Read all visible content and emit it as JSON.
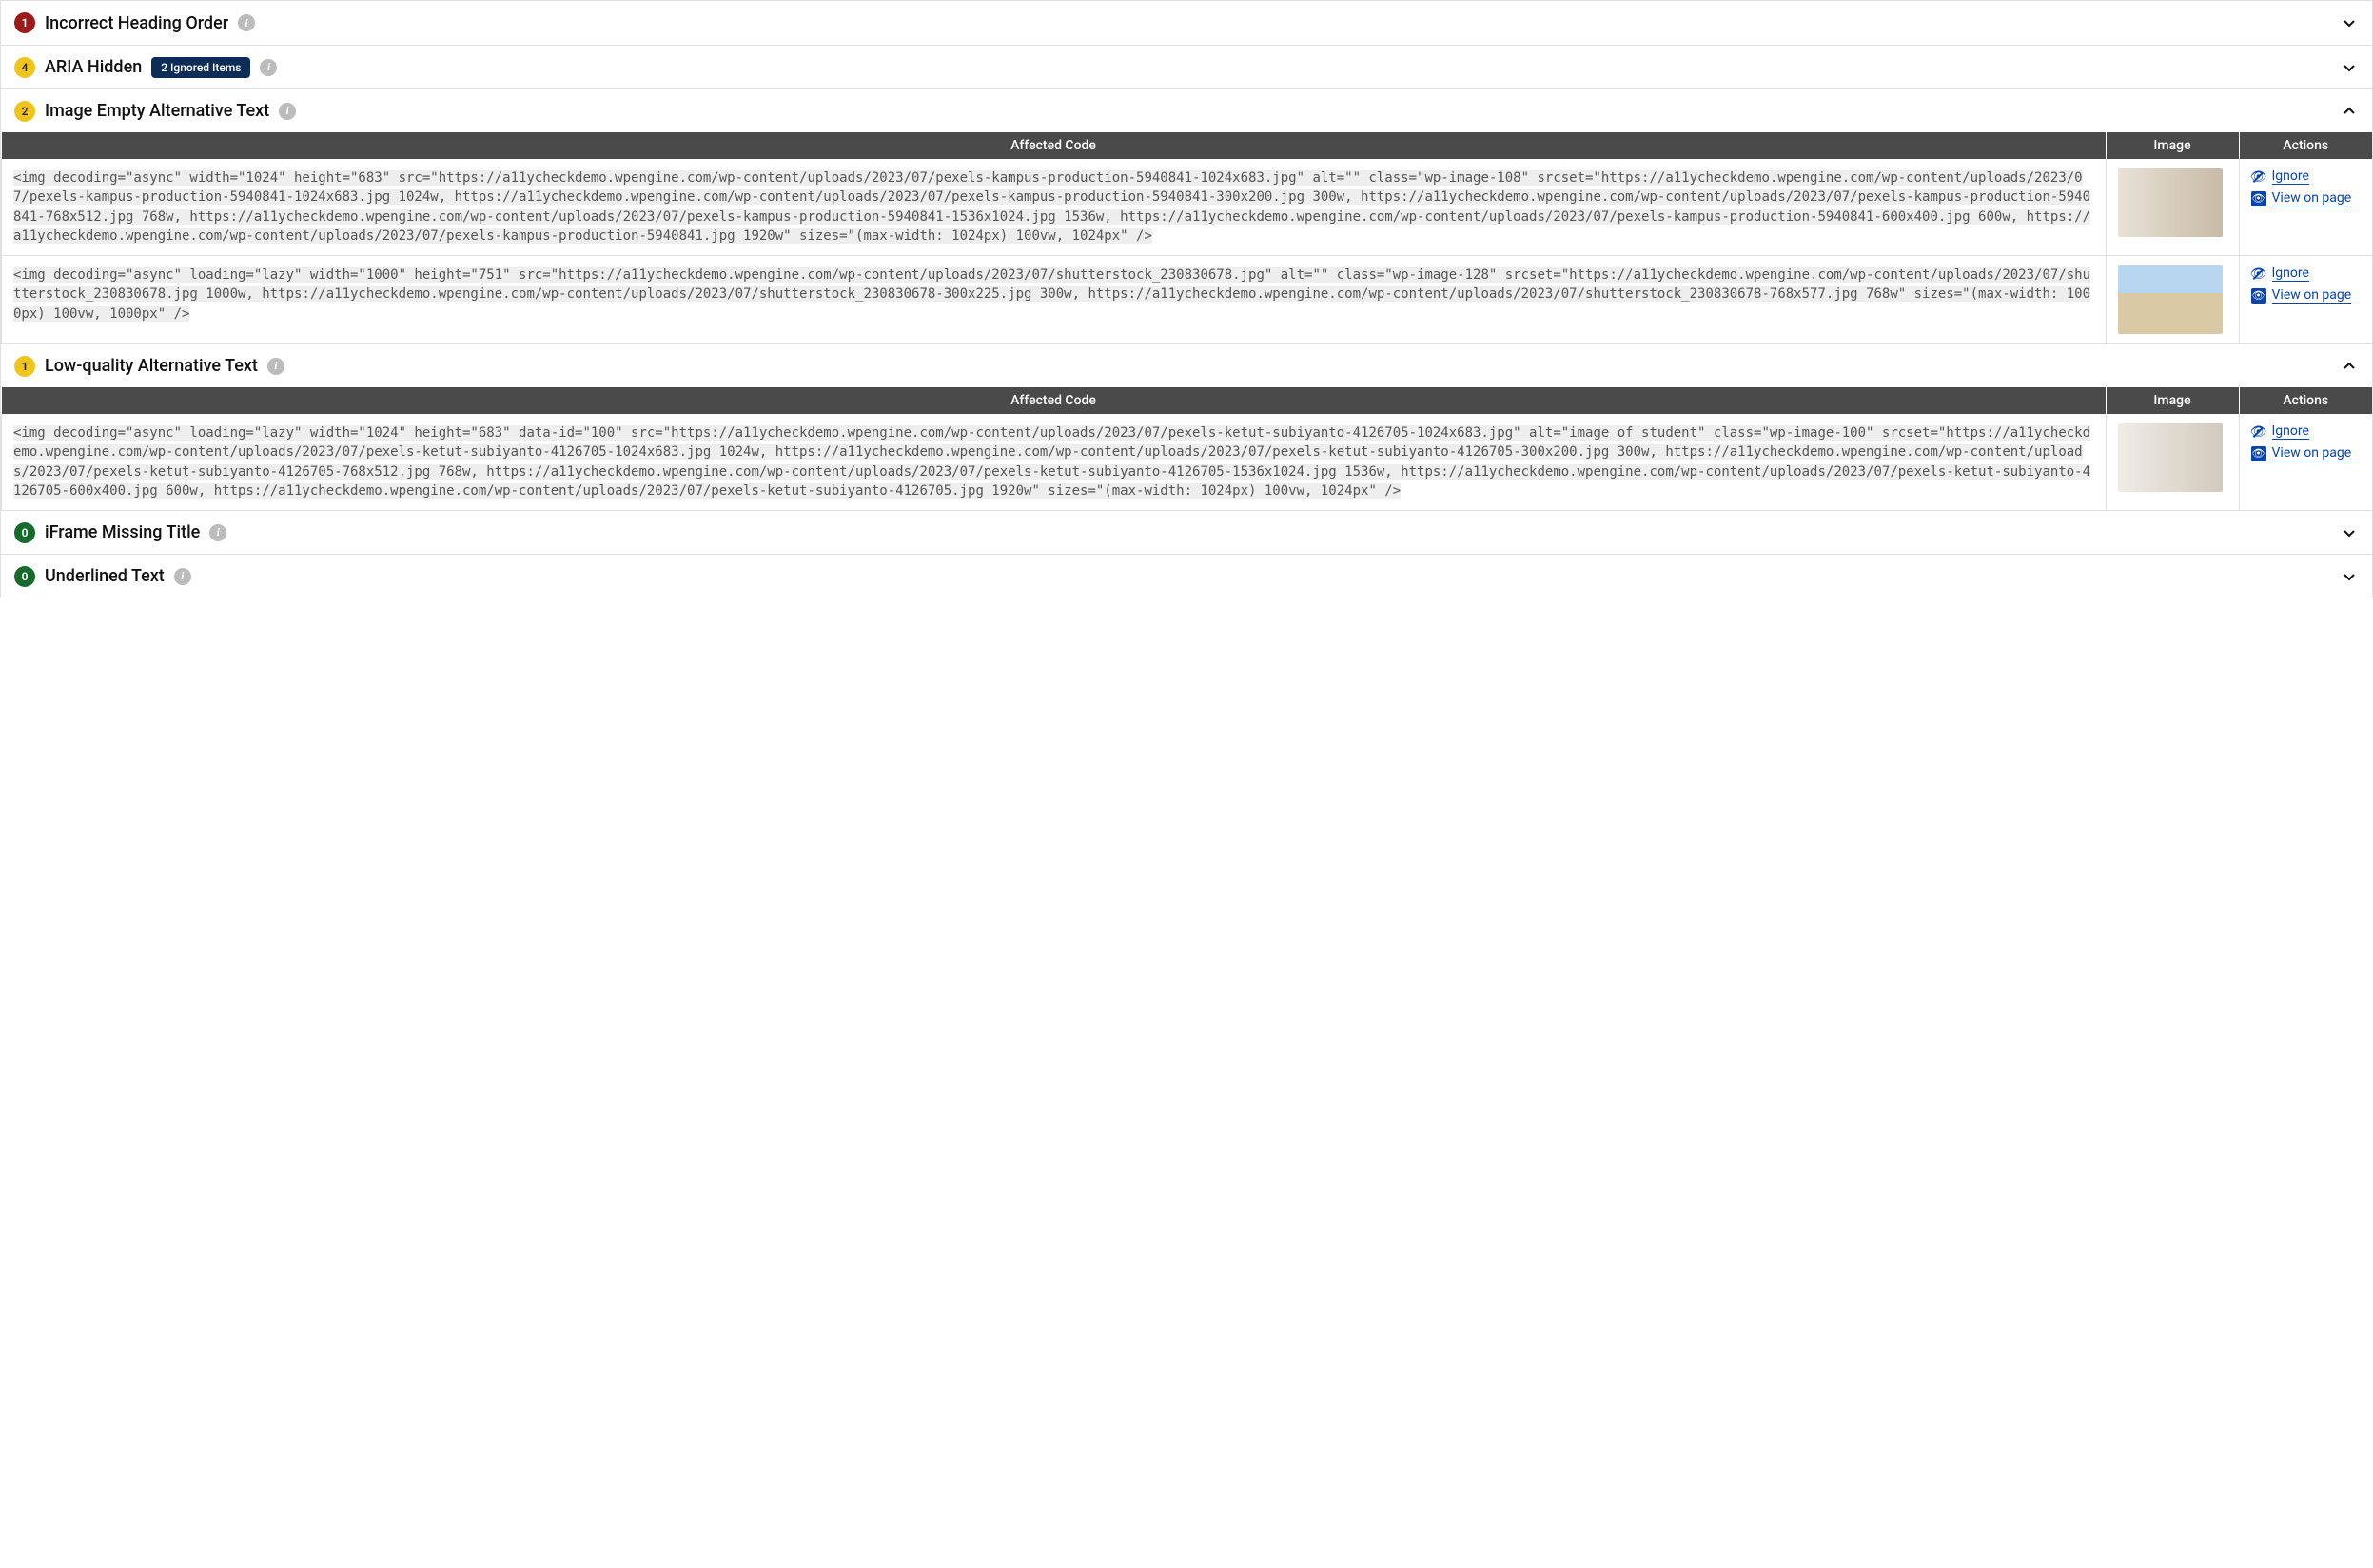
{
  "table": {
    "headers": {
      "code": "Affected Code",
      "image": "Image",
      "actions": "Actions"
    }
  },
  "actions": {
    "ignore": "Ignore",
    "viewOnPage": "View on page"
  },
  "rules": [
    {
      "id": "incorrect-heading-order",
      "count": "1",
      "severity": "red",
      "title": "Incorrect Heading Order",
      "ignoredBadge": null,
      "open": false,
      "hasDetails": false,
      "items": []
    },
    {
      "id": "aria-hidden",
      "count": "4",
      "severity": "yellow",
      "title": "ARIA Hidden",
      "ignoredBadge": "2 Ignored Items",
      "open": false,
      "hasDetails": false,
      "items": []
    },
    {
      "id": "image-empty-alt",
      "count": "2",
      "severity": "yellow",
      "title": "Image Empty Alternative Text",
      "ignoredBadge": null,
      "open": true,
      "hasDetails": true,
      "items": [
        {
          "thumbClass": "people",
          "code": "<img decoding=\"async\" width=\"1024\" height=\"683\" src=\"https://a11ycheckdemo.wpengine.com/wp-content/uploads/2023/07/pexels-kampus-production-5940841-1024x683.jpg\" alt=\"\" class=\"wp-image-108\" srcset=\"https://a11ycheckdemo.wpengine.com/wp-content/uploads/2023/07/pexels-kampus-production-5940841-1024x683.jpg 1024w, https://a11ycheckdemo.wpengine.com/wp-content/uploads/2023/07/pexels-kampus-production-5940841-300x200.jpg 300w, https://a11ycheckdemo.wpengine.com/wp-content/uploads/2023/07/pexels-kampus-production-5940841-768x512.jpg 768w, https://a11ycheckdemo.wpengine.com/wp-content/uploads/2023/07/pexels-kampus-production-5940841-1536x1024.jpg 1536w, https://a11ycheckdemo.wpengine.com/wp-content/uploads/2023/07/pexels-kampus-production-5940841-600x400.jpg 600w, https://a11ycheckdemo.wpengine.com/wp-content/uploads/2023/07/pexels-kampus-production-5940841.jpg 1920w\" sizes=\"(max-width: 1024px) 100vw, 1024px\" />"
        },
        {
          "thumbClass": "sky",
          "code": "<img decoding=\"async\" loading=\"lazy\" width=\"1000\" height=\"751\" src=\"https://a11ycheckdemo.wpengine.com/wp-content/uploads/2023/07/shutterstock_230830678.jpg\" alt=\"\" class=\"wp-image-128\" srcset=\"https://a11ycheckdemo.wpengine.com/wp-content/uploads/2023/07/shutterstock_230830678.jpg 1000w, https://a11ycheckdemo.wpengine.com/wp-content/uploads/2023/07/shutterstock_230830678-300x225.jpg 300w, https://a11ycheckdemo.wpengine.com/wp-content/uploads/2023/07/shutterstock_230830678-768x577.jpg 768w\" sizes=\"(max-width: 1000px) 100vw, 1000px\" />"
        }
      ]
    },
    {
      "id": "low-quality-alt",
      "count": "1",
      "severity": "yellow",
      "title": "Low-quality Alternative Text",
      "ignoredBadge": null,
      "open": true,
      "hasDetails": true,
      "items": [
        {
          "thumbClass": "laptop",
          "code": "<img decoding=\"async\" loading=\"lazy\" width=\"1024\" height=\"683\" data-id=\"100\" src=\"https://a11ycheckdemo.wpengine.com/wp-content/uploads/2023/07/pexels-ketut-subiyanto-4126705-1024x683.jpg\" alt=\"image of student\" class=\"wp-image-100\" srcset=\"https://a11ycheckdemo.wpengine.com/wp-content/uploads/2023/07/pexels-ketut-subiyanto-4126705-1024x683.jpg 1024w, https://a11ycheckdemo.wpengine.com/wp-content/uploads/2023/07/pexels-ketut-subiyanto-4126705-300x200.jpg 300w, https://a11ycheckdemo.wpengine.com/wp-content/uploads/2023/07/pexels-ketut-subiyanto-4126705-768x512.jpg 768w, https://a11ycheckdemo.wpengine.com/wp-content/uploads/2023/07/pexels-ketut-subiyanto-4126705-1536x1024.jpg 1536w, https://a11ycheckdemo.wpengine.com/wp-content/uploads/2023/07/pexels-ketut-subiyanto-4126705-600x400.jpg 600w, https://a11ycheckdemo.wpengine.com/wp-content/uploads/2023/07/pexels-ketut-subiyanto-4126705.jpg 1920w\" sizes=\"(max-width: 1024px) 100vw, 1024px\" />"
        }
      ]
    },
    {
      "id": "iframe-missing-title",
      "count": "0",
      "severity": "green",
      "title": "iFrame Missing Title",
      "ignoredBadge": null,
      "open": false,
      "hasDetails": false,
      "items": []
    },
    {
      "id": "underlined-text",
      "count": "0",
      "severity": "green",
      "title": "Underlined Text",
      "ignoredBadge": null,
      "open": false,
      "hasDetails": false,
      "items": []
    }
  ]
}
